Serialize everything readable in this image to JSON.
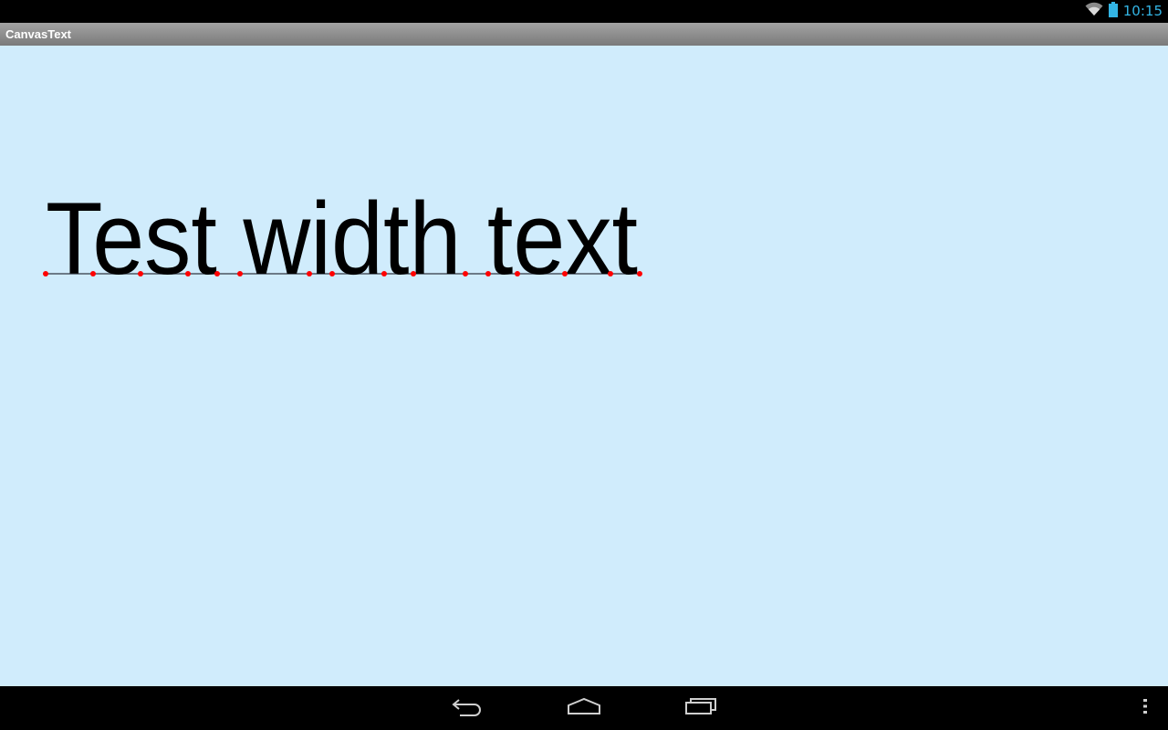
{
  "status_bar": {
    "time": "10:15",
    "icons": [
      "wifi-icon",
      "battery-icon"
    ],
    "accent_color": "#33b5e5"
  },
  "app": {
    "title": "CanvasText"
  },
  "canvas": {
    "background_color": "#d0ecfc",
    "text": "Test width text",
    "text_color": "#000000",
    "baseline_color": "#4a5560",
    "marker_color": "#ff0000"
  },
  "nav_bar": {
    "buttons": [
      "back-icon",
      "home-icon",
      "recent-apps-icon"
    ],
    "overflow": "overflow-menu-icon"
  }
}
